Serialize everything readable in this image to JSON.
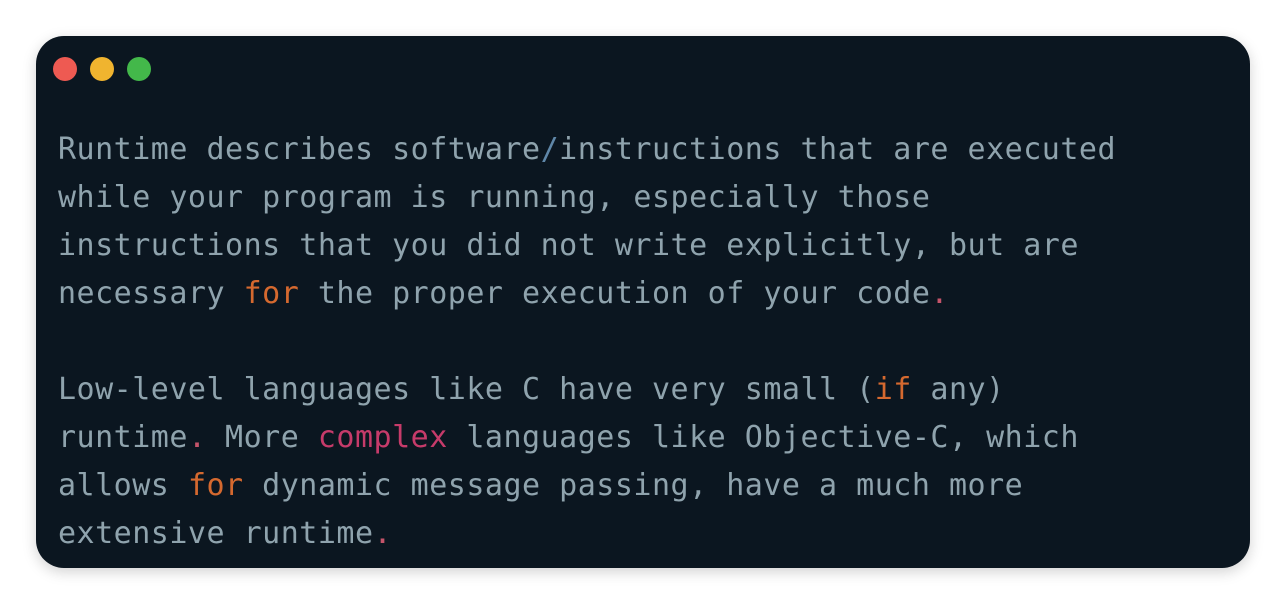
{
  "window": {
    "buttons": {
      "close_color": "#ee5a52",
      "minimize_color": "#f0b42f",
      "maximize_color": "#43b84a"
    },
    "background": "#0b1620",
    "text_color": "#8fa3ad",
    "keyword_color": "#d5692f",
    "accent_color": "#c63b6a"
  },
  "paragraph1": {
    "l1_a": "Runtime describes software",
    "l1_slash": "/",
    "l1_b": "instructions that are executed",
    "l2": "while your program is running, especially those",
    "l3": "instructions that you did not write explicitly, but are",
    "l4_a": "necessary ",
    "l4_kw": "for",
    "l4_b": " the proper execution of your code",
    "l4_dot": "."
  },
  "paragraph2": {
    "l1_a": "Low-level languages like C have very small (",
    "l1_kw": "if",
    "l1_b": " any)",
    "l2_a": "runtime",
    "l2_dot": ".",
    "l2_b": " More ",
    "l2_kw": "complex",
    "l2_c": " languages like Objective-C, which",
    "l3_a": "allows ",
    "l3_kw": "for",
    "l3_b": " dynamic message passing, have a much more",
    "l4_a": "extensive runtime",
    "l4_dot": "."
  }
}
